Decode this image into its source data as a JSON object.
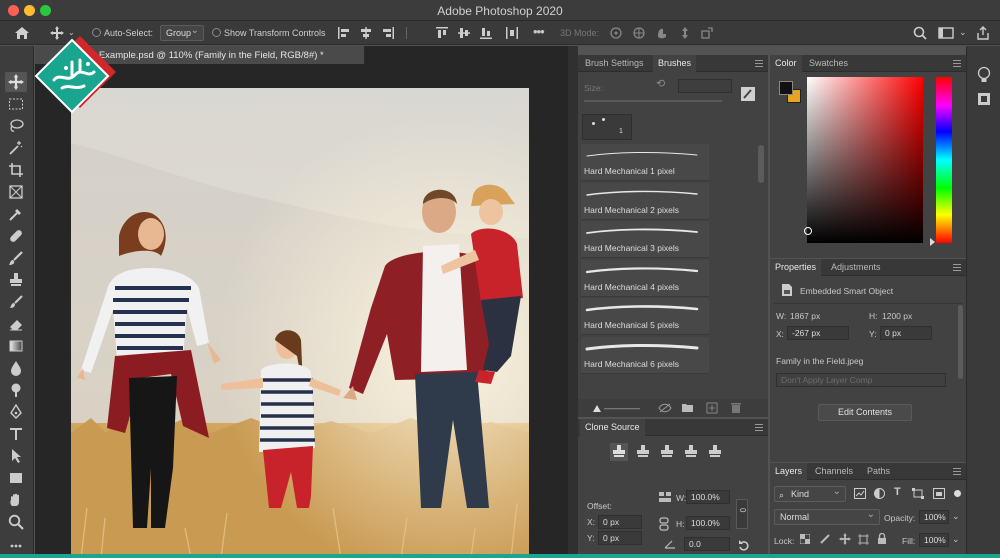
{
  "app": {
    "title": "Adobe Photoshop 2020"
  },
  "window_controls": {
    "close_color": "#fe5f57",
    "minimize_color": "#febc2e",
    "zoom_color": "#28c840"
  },
  "options_bar": {
    "auto_select_label": "Auto-Select:",
    "auto_select_mode": "Group",
    "show_transform_label": "Show Transform Controls",
    "mode_3d_label": "3D Mode:"
  },
  "document": {
    "tab_title": "om Example.psd @ 110% (Family in the Field, RGB/8#) *"
  },
  "brushes_panel": {
    "tabs": [
      "Brush Settings",
      "Brushes"
    ],
    "active_tab": "Brushes",
    "size_label": "Size:",
    "preset_size": "1",
    "items": [
      {
        "label": "Hard Mechanical 1 pixel",
        "stroke": 1
      },
      {
        "label": "Hard Mechanical 2 pixels",
        "stroke": 1.4
      },
      {
        "label": "Hard Mechanical 3 pixels",
        "stroke": 1.8
      },
      {
        "label": "Hard Mechanical 4 pixels",
        "stroke": 2.2
      },
      {
        "label": "Hard Mechanical 5 pixels",
        "stroke": 2.6
      },
      {
        "label": "Hard Mechanical 6 pixels",
        "stroke": 3.0
      }
    ]
  },
  "clone_source_panel": {
    "title": "Clone Source",
    "offset_label": "Offset:",
    "x_label": "X:",
    "x_value": "0 px",
    "y_label": "Y:",
    "y_value": "0 px",
    "w_label": "W:",
    "w_value": "100.0%",
    "h_label": "H:",
    "h_value": "100.0%",
    "angle_value": "0.0",
    "frame_value": "0"
  },
  "color_panel": {
    "tabs": [
      "Color",
      "Swatches"
    ],
    "active_tab": "Color",
    "foreground": "#111111",
    "background": "#e8a321",
    "hue_color": "#ff0000"
  },
  "properties_panel": {
    "tabs": [
      "Properties",
      "Adjustments"
    ],
    "active_tab": "Properties",
    "object_type": "Embedded Smart Object",
    "w_label": "W:",
    "w_value": "1867 px",
    "h_label": "H:",
    "h_value": "1200 px",
    "x_label": "X:",
    "x_value": "-267 px",
    "y_label": "Y:",
    "y_value": "0 px",
    "source_file": "Family in the Field.jpeg",
    "layer_comp_placeholder": "Don't Apply Layer Comp",
    "edit_button": "Edit Contents"
  },
  "layers_panel": {
    "tabs": [
      "Layers",
      "Channels",
      "Paths"
    ],
    "active_tab": "Layers",
    "filter_label": "Kind",
    "blend_mode": "Normal",
    "opacity_label": "Opacity:",
    "opacity_value": "100%",
    "lock_label": "Lock:",
    "fill_label": "Fill:",
    "fill_value": "100%"
  },
  "logo": {
    "text": "یاد بگیریم"
  },
  "brand_color": "#1aa58e"
}
